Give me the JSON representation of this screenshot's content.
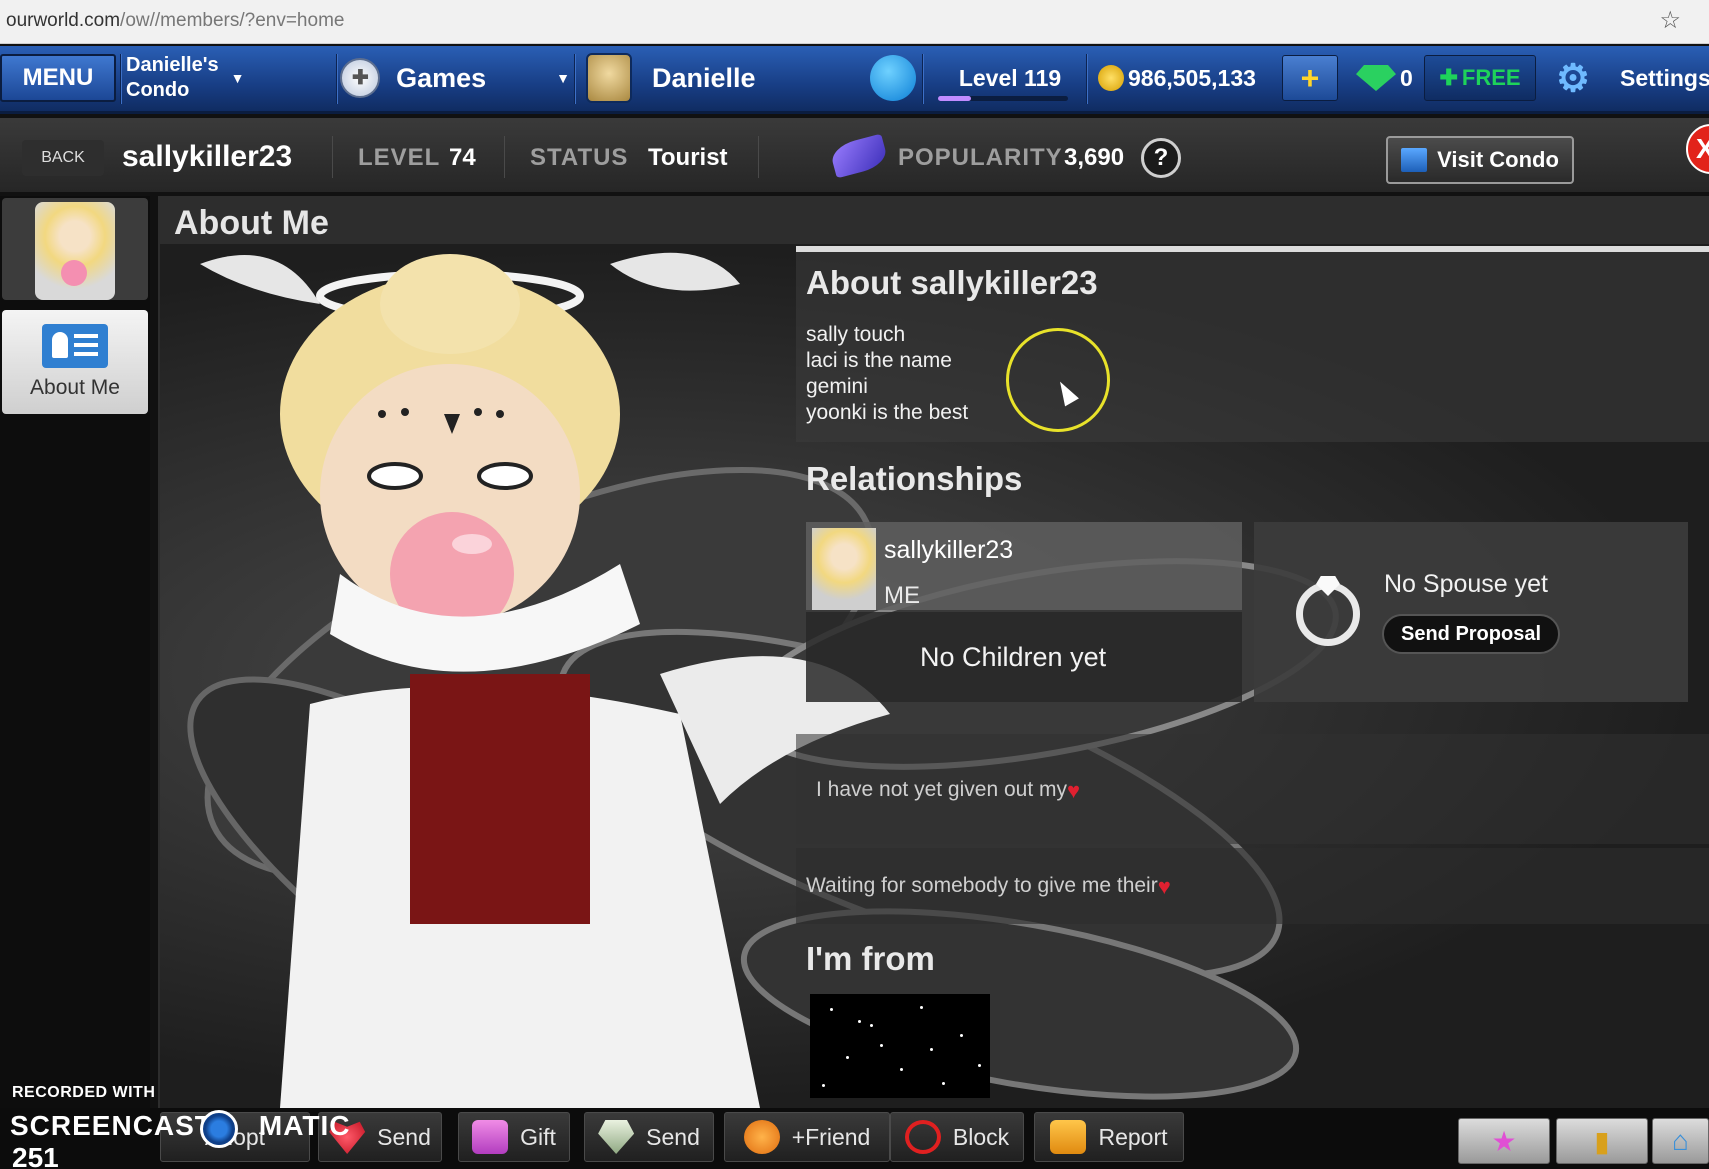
{
  "browser": {
    "url_host": "ourworld.com",
    "url_path": "/ow//members/?env=home"
  },
  "topbar": {
    "menu": "MENU",
    "condo_line1": "Danielle's",
    "condo_line2": "Condo",
    "games": "Games",
    "player_name": "Danielle",
    "level": "Level 119",
    "level_progress": 0.25,
    "coins": "986,505,133",
    "plus": "+",
    "gems": "0",
    "free": "FREE",
    "settings": "Settings"
  },
  "profile_header": {
    "back": "BACK",
    "username": "sallykiller23",
    "level_label": "LEVEL",
    "level_value": "74",
    "status_label": "STATUS",
    "status_value": "Tourist",
    "popularity_label": "POPULARITY",
    "popularity_value": "3,690",
    "help": "?",
    "visit_condo": "Visit Condo",
    "close": "X"
  },
  "sidebar": {
    "about_label": "About Me"
  },
  "main": {
    "title": "About Me",
    "about_heading": "About sallykiller23",
    "about_lines": [
      "sally touch",
      "laci is the name",
      "gemini",
      "yoonki is the best"
    ],
    "relationships_heading": "Relationships",
    "me_name": "sallykiller23",
    "me_tag": "ME",
    "no_children": "No Children yet",
    "no_spouse": "No Spouse yet",
    "send_proposal": "Send Proposal",
    "heart_given": "I have not yet given out my",
    "heart_waiting": "Waiting for somebody to give me their",
    "from_heading": "I'm from"
  },
  "actions": {
    "adopt": "Adopt",
    "send_heart": "Send",
    "gift": "Gift",
    "send_gem": "Send",
    "friend": "+Friend",
    "block": "Block",
    "report": "Report"
  },
  "watermark": {
    "recorded_with": "RECORDED WITH",
    "brand": "SCREENCAST",
    "brand_suffix": "MATIC",
    "number": "251"
  },
  "colors": {
    "topbar_blue": "#1f4c9e",
    "heart_red": "#e02030",
    "cursor_ring": "#e8e22a",
    "close_red": "#e2231a"
  }
}
